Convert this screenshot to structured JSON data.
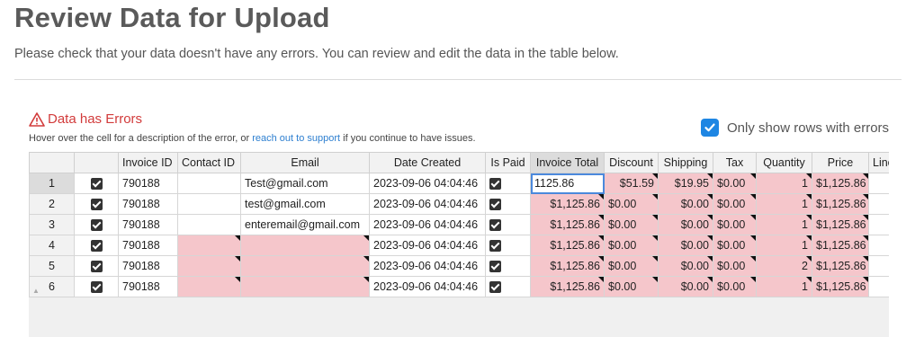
{
  "page": {
    "title": "Review Data for Upload",
    "subtitle": "Please check that your data doesn't have any errors. You can review and edit the data in the table below."
  },
  "errors": {
    "title": "Data has Errors",
    "hint_before": "Hover over the cell for a description of the error, or ",
    "hint_link": "reach out to support",
    "hint_after": " if you continue to have issues."
  },
  "filter": {
    "label": "Only show rows with errors",
    "checked": true
  },
  "table": {
    "columns": [
      "",
      "",
      "Invoice ID",
      "Contact ID",
      "Email",
      "Date Created",
      "Is Paid",
      "Invoice Total",
      "Discount",
      "Shipping",
      "Tax",
      "Quantity",
      "Price",
      "Line"
    ],
    "rows": [
      {
        "num": "1",
        "invoice_id": "790188",
        "contact_id": "",
        "email": "Test@gmail.com",
        "date": "2023-09-06 04:04:46",
        "total": "1125.86",
        "discount": "$51.59",
        "shipping": "$19.95",
        "tax": "$0.00",
        "quantity": "1",
        "price": "$1,125.86"
      },
      {
        "num": "2",
        "invoice_id": "790188",
        "contact_id": "",
        "email": "test@gmail.com",
        "date": "2023-09-06 04:04:46",
        "total": "$1,125.86",
        "discount": "$0.00",
        "shipping": "$0.00",
        "tax": "$0.00",
        "quantity": "1",
        "price": "$1,125.86"
      },
      {
        "num": "3",
        "invoice_id": "790188",
        "contact_id": "",
        "email": "enteremail@gmail.com",
        "date": "2023-09-06 04:04:46",
        "total": "$1,125.86",
        "discount": "$0.00",
        "shipping": "$0.00",
        "tax": "$0.00",
        "quantity": "1",
        "price": "$1,125.86"
      },
      {
        "num": "4",
        "invoice_id": "790188",
        "contact_id": "",
        "email": "",
        "date": "2023-09-06 04:04:46",
        "total": "$1,125.86",
        "discount": "$0.00",
        "shipping": "$0.00",
        "tax": "$0.00",
        "quantity": "1",
        "price": "$1,125.86"
      },
      {
        "num": "5",
        "invoice_id": "790188",
        "contact_id": "",
        "email": "",
        "date": "2023-09-06 04:04:46",
        "total": "$1,125.86",
        "discount": "$0.00",
        "shipping": "$0.00",
        "tax": "$0.00",
        "quantity": "2",
        "price": "$1,125.86"
      },
      {
        "num": "6",
        "invoice_id": "790188",
        "contact_id": "",
        "email": "",
        "date": "2023-09-06 04:04:46",
        "total": "$1,125.86",
        "discount": "$0.00",
        "shipping": "$0.00",
        "tax": "$0.00",
        "quantity": "1",
        "price": "$1,125.86"
      }
    ]
  },
  "colors": {
    "error_cell": "#f5c6cb",
    "error_text": "#d23b3b",
    "link": "#2d7fd0",
    "checkbox_accent": "#1e86e3"
  },
  "icons": {
    "error": "warning-triangle-icon",
    "filter": "checkbox-checked-icon",
    "row_check": "checkbox-checked-icon"
  }
}
